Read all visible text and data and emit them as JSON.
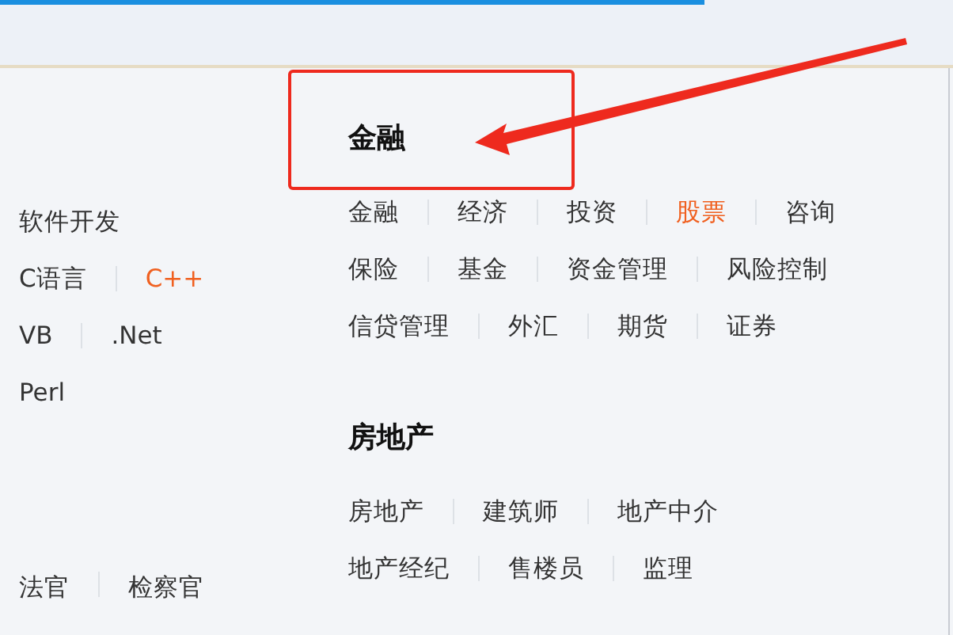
{
  "left_column": {
    "groups": [
      {
        "rows": [
          [
            {
              "label": "软件开发",
              "highlighted": false
            }
          ],
          [
            {
              "label": "C语言",
              "highlighted": false
            },
            {
              "label": "C++",
              "highlighted": true
            }
          ],
          [
            {
              "label": "VB",
              "highlighted": false
            },
            {
              "label": ".Net",
              "highlighted": false
            }
          ],
          [
            {
              "label": "Perl",
              "highlighted": false
            }
          ]
        ]
      },
      {
        "rows": [
          [
            {
              "label": "法官",
              "highlighted": false
            },
            {
              "label": "检察官",
              "highlighted": false
            }
          ]
        ]
      }
    ]
  },
  "right_column": {
    "sections": [
      {
        "heading": "金融",
        "rows": [
          [
            {
              "label": "金融",
              "highlighted": false
            },
            {
              "label": "经济",
              "highlighted": false
            },
            {
              "label": "投资",
              "highlighted": false
            },
            {
              "label": "股票",
              "highlighted": true
            },
            {
              "label": "咨询",
              "highlighted": false
            }
          ],
          [
            {
              "label": "保险",
              "highlighted": false
            },
            {
              "label": "基金",
              "highlighted": false
            },
            {
              "label": "资金管理",
              "highlighted": false
            },
            {
              "label": "风险控制",
              "highlighted": false
            }
          ],
          [
            {
              "label": "信贷管理",
              "highlighted": false
            },
            {
              "label": "外汇",
              "highlighted": false
            },
            {
              "label": "期货",
              "highlighted": false
            },
            {
              "label": "证券",
              "highlighted": false
            }
          ]
        ]
      },
      {
        "heading": "房地产",
        "rows": [
          [
            {
              "label": "房地产",
              "highlighted": false
            },
            {
              "label": "建筑师",
              "highlighted": false
            },
            {
              "label": "地产中介",
              "highlighted": false
            }
          ],
          [
            {
              "label": "地产经纪",
              "highlighted": false
            },
            {
              "label": "售楼员",
              "highlighted": false
            },
            {
              "label": "监理",
              "highlighted": false
            }
          ]
        ]
      }
    ]
  }
}
